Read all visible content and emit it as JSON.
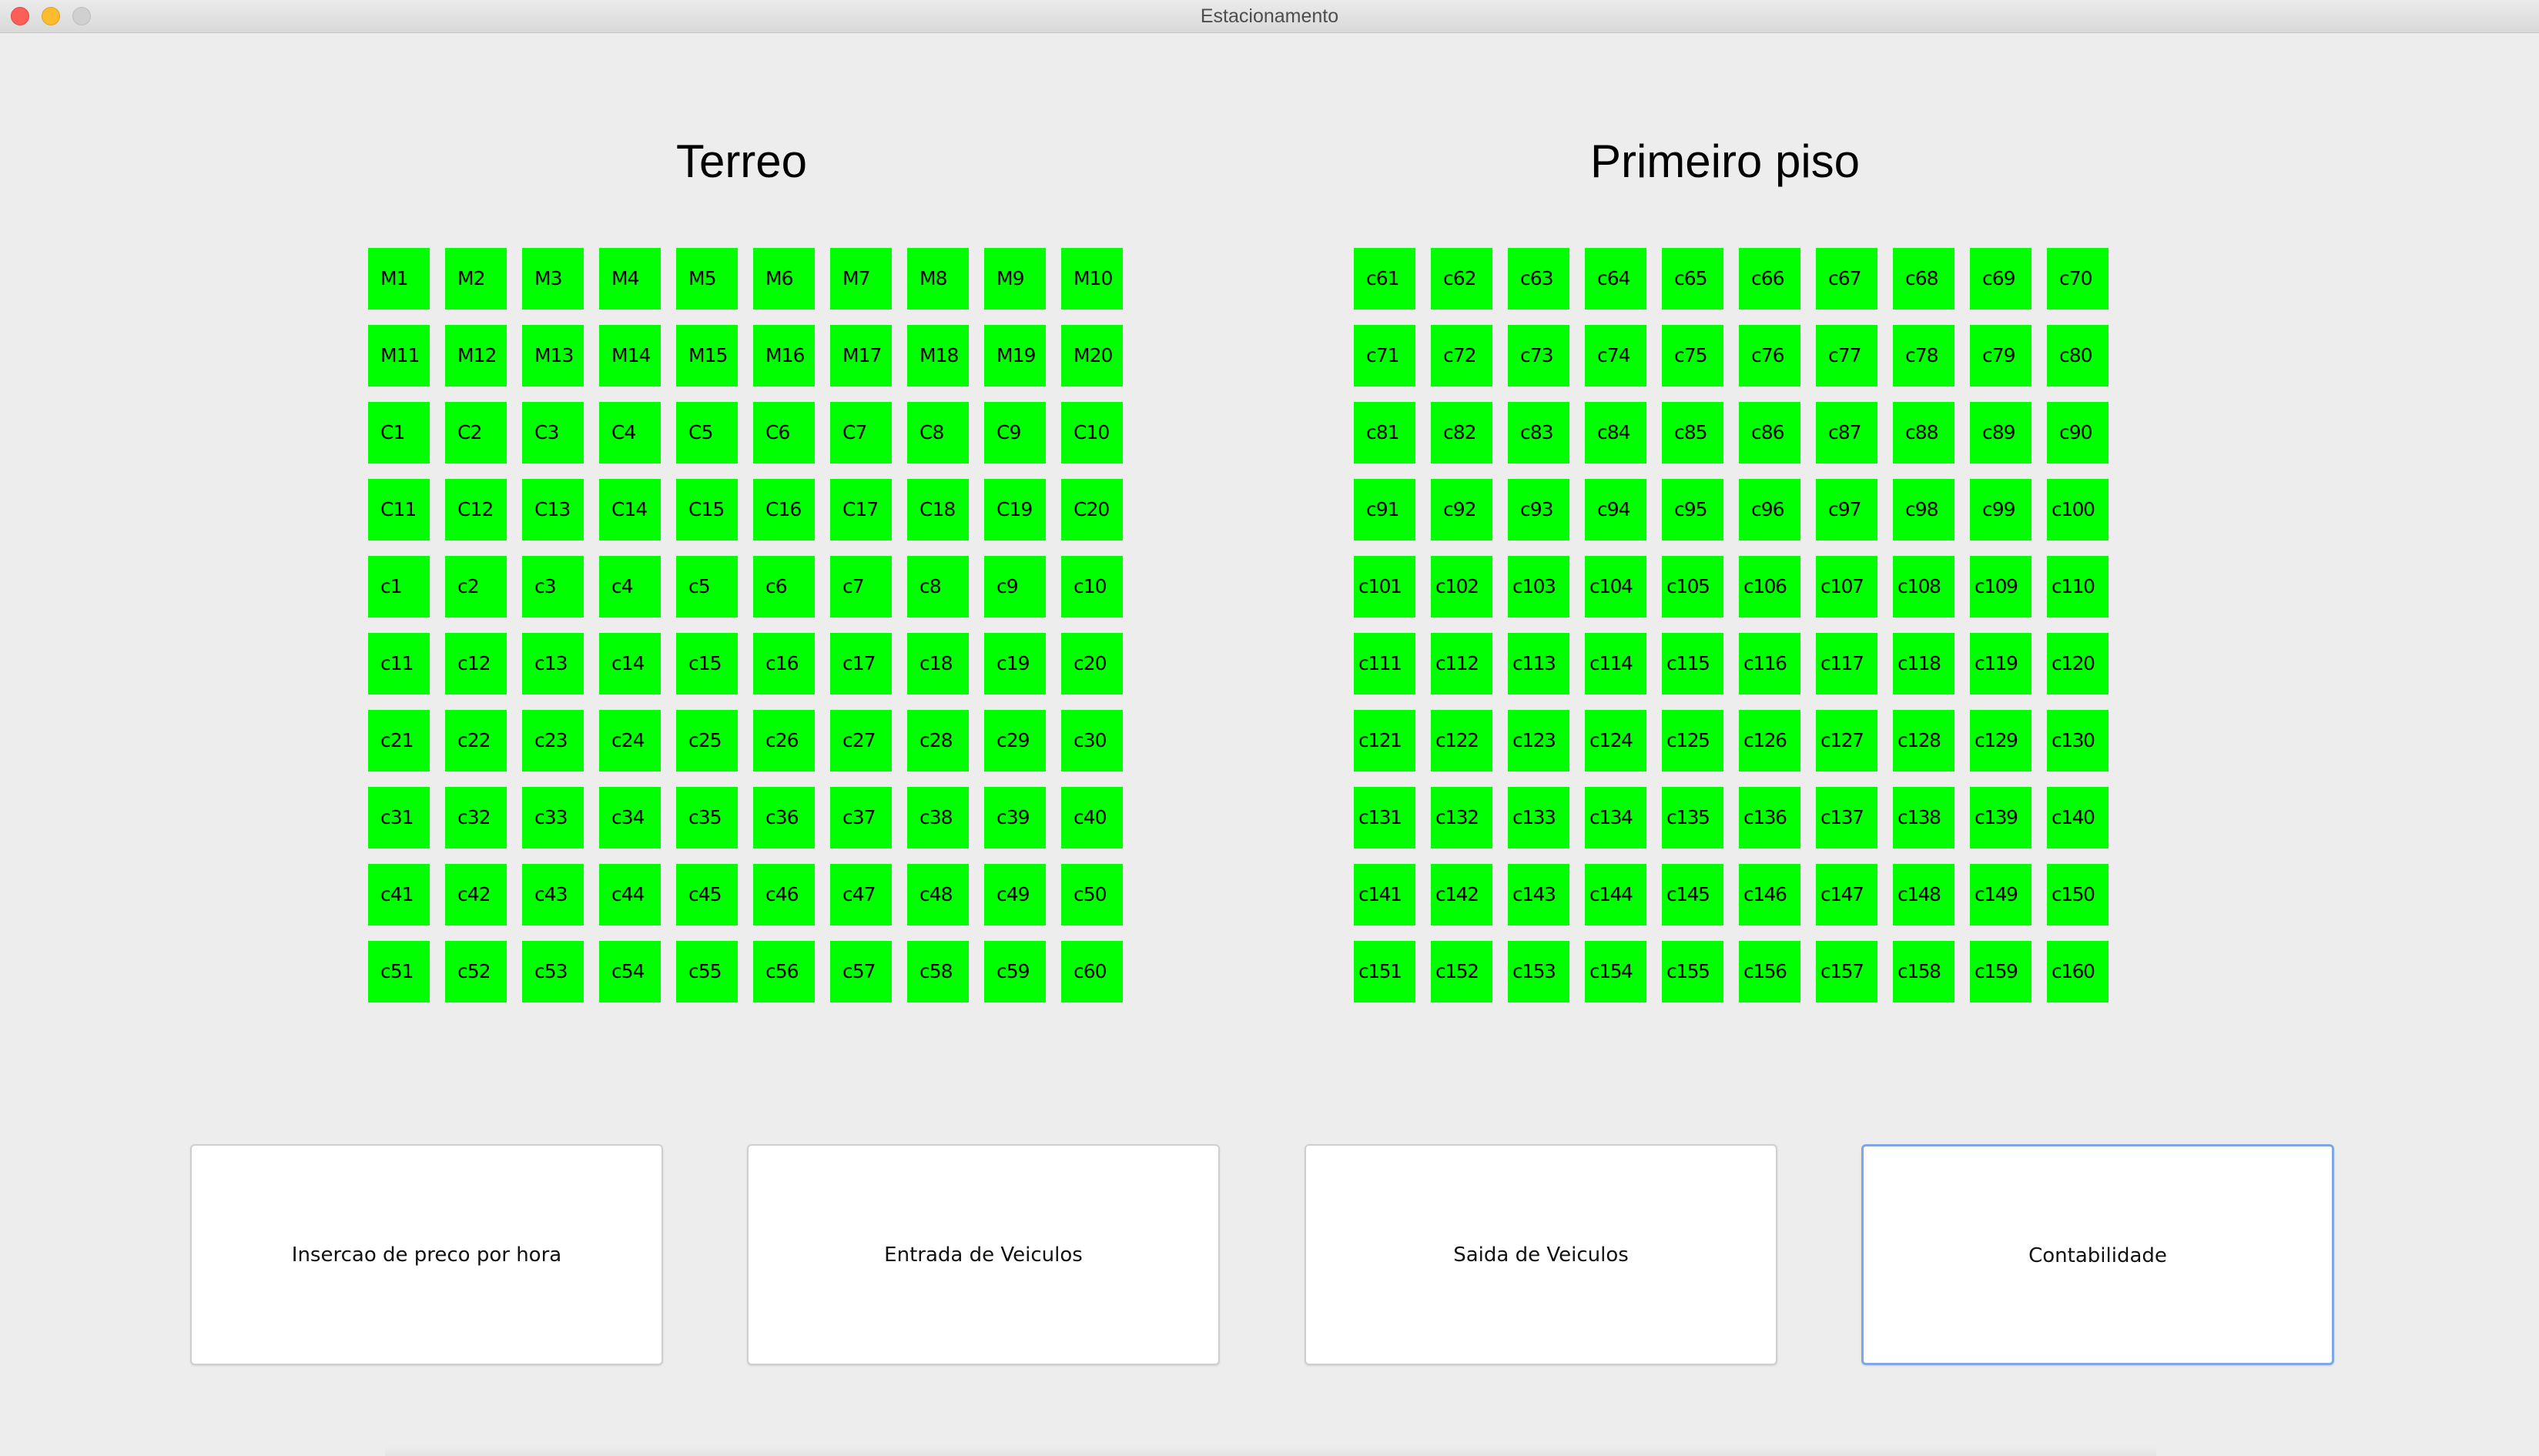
{
  "window": {
    "title": "Estacionamento",
    "controls": [
      "close-icon",
      "minimize-icon",
      "zoom-icon"
    ]
  },
  "floors": [
    {
      "title": "Terreo",
      "spots": [
        "M1",
        "M2",
        "M3",
        "M4",
        "M5",
        "M6",
        "M7",
        "M8",
        "M9",
        "M10",
        "M11",
        "M12",
        "M13",
        "M14",
        "M15",
        "M16",
        "M17",
        "M18",
        "M19",
        "M20",
        "C1",
        "C2",
        "C3",
        "C4",
        "C5",
        "C6",
        "C7",
        "C8",
        "C9",
        "C10",
        "C11",
        "C12",
        "C13",
        "C14",
        "C15",
        "C16",
        "C17",
        "C18",
        "C19",
        "C20",
        "c1",
        "c2",
        "c3",
        "c4",
        "c5",
        "c6",
        "c7",
        "c8",
        "c9",
        "c10",
        "c11",
        "c12",
        "c13",
        "c14",
        "c15",
        "c16",
        "c17",
        "c18",
        "c19",
        "c20",
        "c21",
        "c22",
        "c23",
        "c24",
        "c25",
        "c26",
        "c27",
        "c28",
        "c29",
        "c30",
        "c31",
        "c32",
        "c33",
        "c34",
        "c35",
        "c36",
        "c37",
        "c38",
        "c39",
        "c40",
        "c41",
        "c42",
        "c43",
        "c44",
        "c45",
        "c46",
        "c47",
        "c48",
        "c49",
        "c50",
        "c51",
        "c52",
        "c53",
        "c54",
        "c55",
        "c56",
        "c57",
        "c58",
        "c59",
        "c60"
      ]
    },
    {
      "title": "Primeiro piso",
      "spots": [
        "c61",
        "c62",
        "c63",
        "c64",
        "c65",
        "c66",
        "c67",
        "c68",
        "c69",
        "c70",
        "c71",
        "c72",
        "c73",
        "c74",
        "c75",
        "c76",
        "c77",
        "c78",
        "c79",
        "c80",
        "c81",
        "c82",
        "c83",
        "c84",
        "c85",
        "c86",
        "c87",
        "c88",
        "c89",
        "c90",
        "c91",
        "c92",
        "c93",
        "c94",
        "c95",
        "c96",
        "c97",
        "c98",
        "c99",
        "c100",
        "c101",
        "c102",
        "c103",
        "c104",
        "c105",
        "c106",
        "c107",
        "c108",
        "c109",
        "c110",
        "c111",
        "c112",
        "c113",
        "c114",
        "c115",
        "c116",
        "c117",
        "c118",
        "c119",
        "c120",
        "c121",
        "c122",
        "c123",
        "c124",
        "c125",
        "c126",
        "c127",
        "c128",
        "c129",
        "c130",
        "c131",
        "c132",
        "c133",
        "c134",
        "c135",
        "c136",
        "c137",
        "c138",
        "c139",
        "c140",
        "c141",
        "c142",
        "c143",
        "c144",
        "c145",
        "c146",
        "c147",
        "c148",
        "c149",
        "c150",
        "c151",
        "c152",
        "c153",
        "c154",
        "c155",
        "c156",
        "c157",
        "c158",
        "c159",
        "c160"
      ]
    }
  ],
  "spot_color": "#00ff00",
  "actions": {
    "insercao_label": "Insercao de preco por hora",
    "entrada_label": "Entrada de Veiculos",
    "saida_label": "Saida de Veiculos",
    "contabilidade_label": "Contabilidade"
  },
  "focus_color": "#7fa7e6"
}
